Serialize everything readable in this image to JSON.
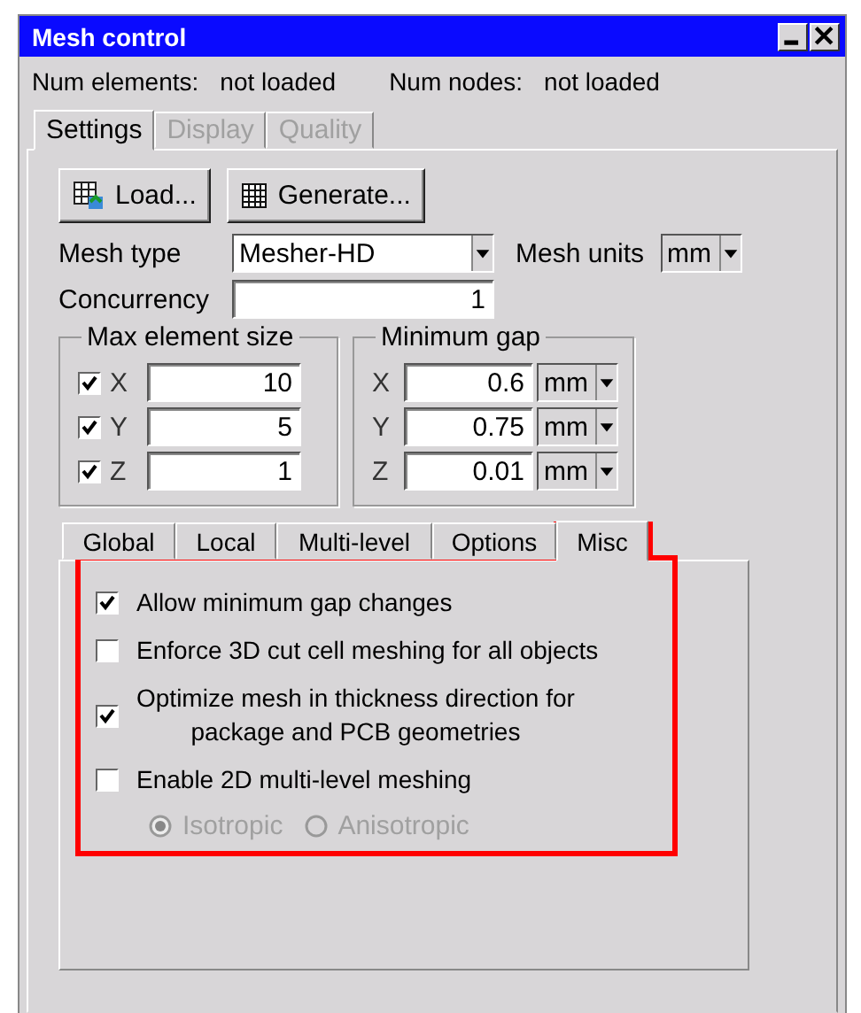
{
  "window": {
    "title": "Mesh control"
  },
  "info": [
    {
      "label": "Num elements:",
      "value": "not loaded"
    },
    {
      "label": "Num nodes:",
      "value": "not loaded"
    }
  ],
  "tabs": [
    {
      "label": "Settings",
      "selected": true,
      "disabled": false
    },
    {
      "label": "Display",
      "selected": false,
      "disabled": true
    },
    {
      "label": "Quality",
      "selected": false,
      "disabled": true
    }
  ],
  "toolbar": [
    {
      "label": "Load...",
      "kind": "load"
    },
    {
      "label": "Generate...",
      "kind": "generate"
    }
  ],
  "mesh_type": {
    "label": "Mesh type",
    "value": "Mesher-HD"
  },
  "mesh_units": {
    "label": "Mesh units",
    "value": "mm"
  },
  "concurrency": {
    "label": "Concurrency",
    "value": "1"
  },
  "max_element_size": {
    "title": "Max element size",
    "rows": [
      {
        "axis": "X",
        "checked": true,
        "value": "10"
      },
      {
        "axis": "Y",
        "checked": true,
        "value": "5"
      },
      {
        "axis": "Z",
        "checked": true,
        "value": "1"
      }
    ]
  },
  "minimum_gap": {
    "title": "Minimum gap",
    "rows": [
      {
        "axis": "X",
        "value": "0.6",
        "unit": "mm"
      },
      {
        "axis": "Y",
        "value": "0.75",
        "unit": "mm"
      },
      {
        "axis": "Z",
        "value": "0.01",
        "unit": "mm"
      }
    ]
  },
  "sub_tabs": [
    {
      "label": "Global",
      "selected": false
    },
    {
      "label": "Local",
      "selected": false
    },
    {
      "label": "Multi-level",
      "selected": false
    },
    {
      "label": "Options",
      "selected": false
    },
    {
      "label": "Misc",
      "selected": true
    }
  ],
  "misc_options": [
    {
      "label": "Allow minimum gap changes",
      "checked": true
    },
    {
      "label": "Enforce 3D cut cell meshing for all objects",
      "checked": false
    },
    {
      "label": "Optimize mesh in thickness direction for\npackage and PCB geometries",
      "checked": true
    },
    {
      "label": "Enable 2D multi-level meshing",
      "checked": false
    }
  ],
  "multi_level_mode": [
    {
      "label": "Isotropic",
      "selected": true,
      "disabled": true
    },
    {
      "label": "Anisotropic",
      "selected": false,
      "disabled": true
    }
  ],
  "annotation": {
    "shown": true
  }
}
